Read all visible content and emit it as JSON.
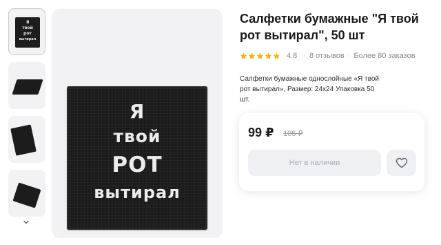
{
  "gallery": {
    "thumb_text": [
      "Я",
      "твой",
      "рот",
      "вытирал"
    ],
    "main_image_text": [
      "Я",
      "твой",
      "РОТ",
      "вытирал"
    ]
  },
  "product": {
    "title": "Салфетки бумажные \"Я твой рот вытирал\", 50 шт",
    "rating": "4.8",
    "rating_value": 4.8,
    "reviews": "8 отзывов",
    "orders": "Более 80 заказов",
    "description": "Салфетки бумажные однослойные «Я твой рот вытирал», Размер: 24х24 Упаковка 50 шт."
  },
  "buy": {
    "price": "99 ₽",
    "old_price": "105 ₽",
    "button_label": "Нет в наличии"
  },
  "colors": {
    "star": "#f6b40e",
    "button_bg": "#eef0f4",
    "button_text": "#a9acb4"
  },
  "icons": {
    "down": "chevron-down-icon",
    "favorite": "heart-icon",
    "star": "star-icon"
  }
}
